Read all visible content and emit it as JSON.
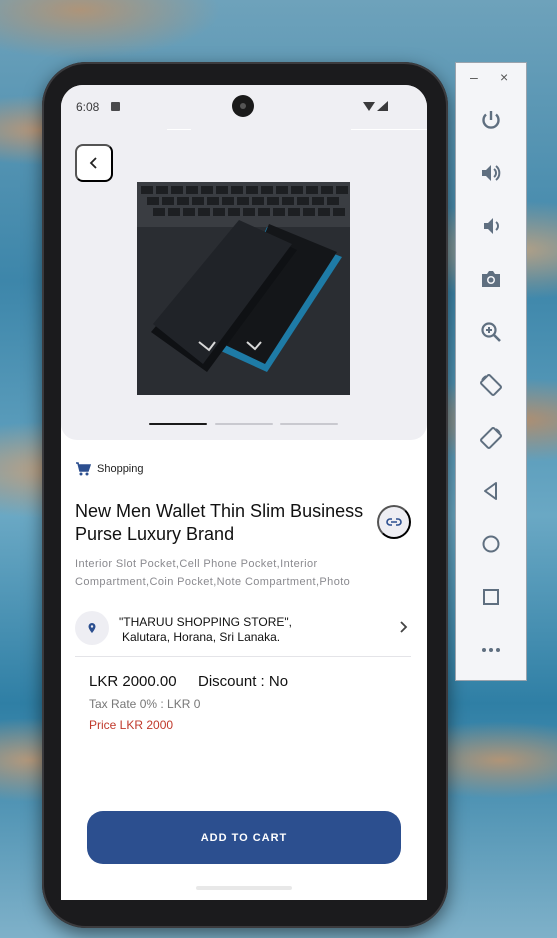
{
  "status_bar": {
    "time": "6:08"
  },
  "product": {
    "category": "Shopping",
    "title": "New Men Wallet Thin Slim Business Purse Luxury Brand",
    "description": "Interior Slot Pocket,Cell Phone Pocket,Interior Compartment,Coin Pocket,Note Compartment,Photo",
    "image_count": 3,
    "active_image_index": 0
  },
  "store": {
    "name": "\"THARUU SHOPPING STORE\",",
    "address": "Kalutara, Horana, Sri Lanaka."
  },
  "pricing": {
    "price": "LKR 2000.00",
    "discount": "Discount : No",
    "tax": "Tax Rate 0% : LKR 0",
    "final": "Price LKR 2000"
  },
  "actions": {
    "add_to_cart": "ADD TO CART"
  },
  "emulator_panel": {
    "minimize": "–",
    "close": "×",
    "buttons": [
      "power-icon",
      "volume-up-icon",
      "volume-down-icon",
      "camera-icon",
      "zoom-icon",
      "rotate-left-icon",
      "rotate-right-icon",
      "back-icon",
      "home-icon",
      "overview-icon",
      "more-icon"
    ]
  },
  "colors": {
    "accent": "#2c4f8f",
    "price_red": "#c0392b",
    "icon_blue": "#2c4f8f",
    "panel_icon": "#5f6f80"
  }
}
